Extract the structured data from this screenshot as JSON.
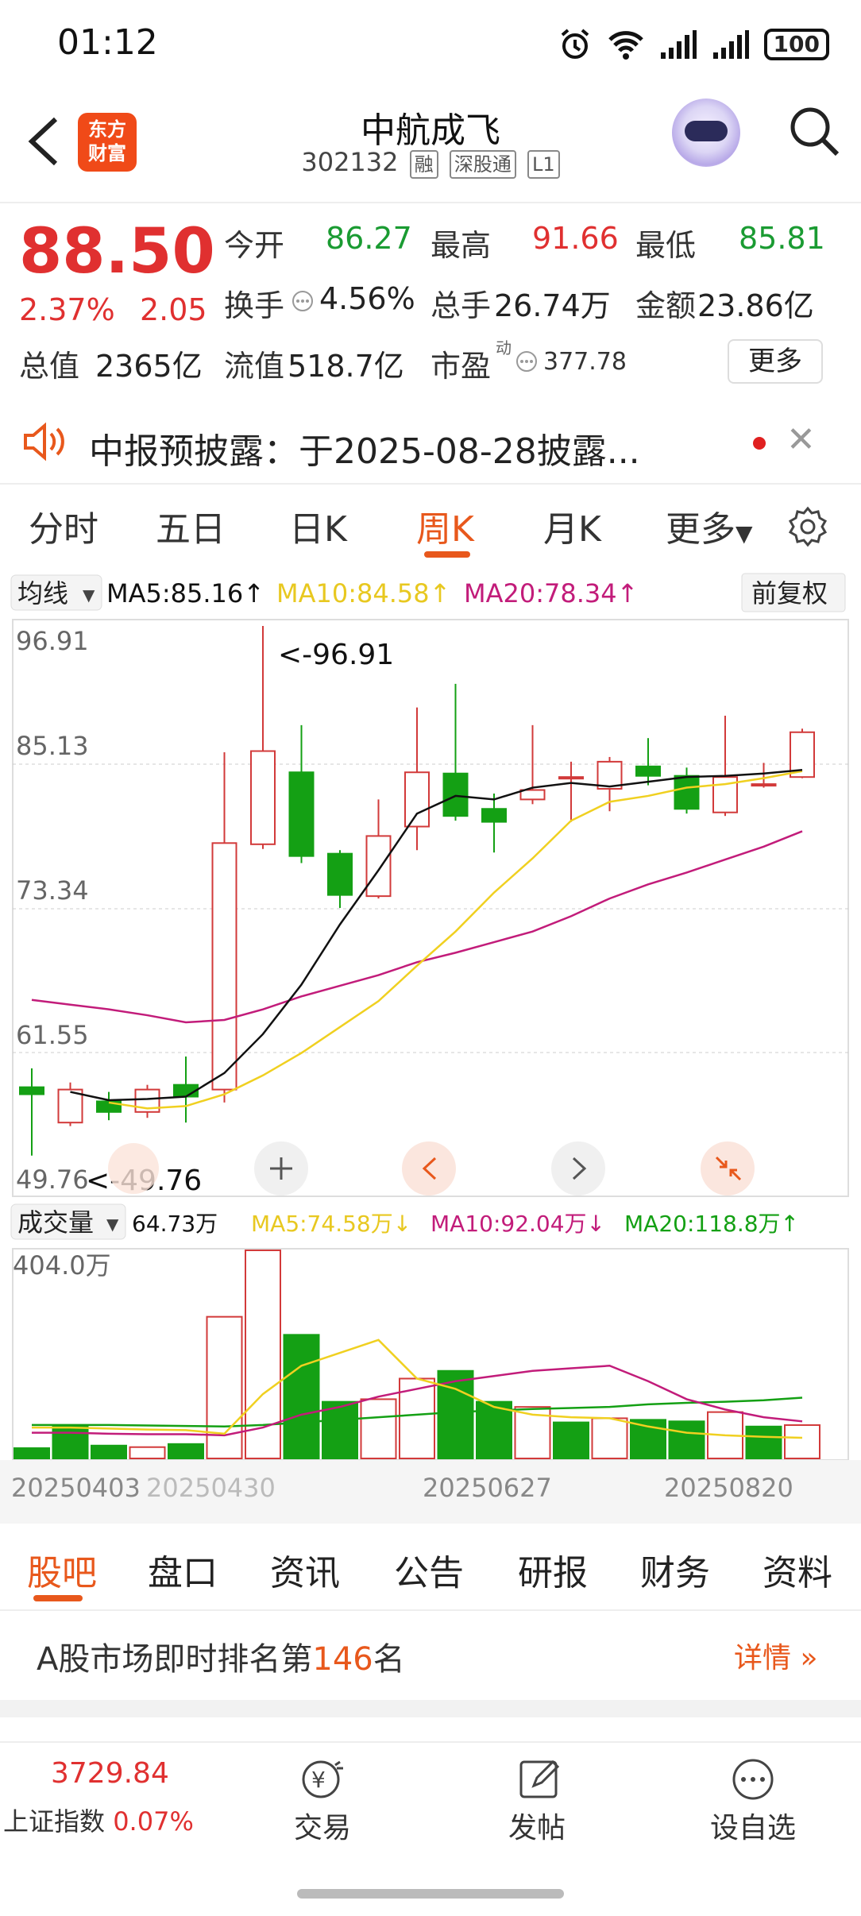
{
  "status": {
    "time": "01:12",
    "battery": "100"
  },
  "header": {
    "logo_line1": "东方",
    "logo_line2": "财富",
    "title": "中航成飞",
    "code": "302132",
    "tags": [
      "融",
      "深股通",
      "L1"
    ]
  },
  "quote": {
    "price": "88.50",
    "change_pct": "2.37%",
    "change": "2.05",
    "open_label": "今开",
    "open": "86.27",
    "high_label": "最高",
    "high": "91.66",
    "low_label": "最低",
    "low": "85.81",
    "turnover_label": "换手",
    "turnover": "4.56%",
    "volume_label": "总手",
    "volume": "26.74万",
    "amount_label": "金额",
    "amount": "23.86亿",
    "mktcap_label": "总值",
    "mktcap": "2365亿",
    "float_label": "流值",
    "float": "518.7亿",
    "pe_label": "市盈",
    "pe_sup": "动",
    "pe": "377.78",
    "more": "更多"
  },
  "notice": {
    "text": "中报预披露：于2025-08-28披露..."
  },
  "period_tabs": [
    "分时",
    "五日",
    "日K",
    "周K",
    "月K",
    "更多"
  ],
  "active_period": "周K",
  "chart_labels": {
    "ma_selector": "均线",
    "ma5": "MA5:85.16↑",
    "ma10": "MA10:84.58↑",
    "ma20": "MA20:78.34↑",
    "fq": "前复权",
    "y_ticks": [
      "96.91",
      "85.13",
      "73.34",
      "61.55",
      "49.76"
    ],
    "max_annot": "<-96.91",
    "min_annot": "<-49.76",
    "vol_selector": "成交量",
    "vol_now": "64.73万",
    "vol_ma5": "MA5:74.58万↓",
    "vol_ma10": "MA10:92.04万↓",
    "vol_ma20": "MA20:118.8万↑",
    "vol_max": "404.0万",
    "x_ticks": [
      "20250403",
      "20250430",
      "20250627",
      "20250820"
    ]
  },
  "colors": {
    "up": "#d23a3a",
    "down": "#14a014",
    "ma5": "#111111",
    "ma10": "#f0d020",
    "ma20": "#c21c7a",
    "accent": "#e8581c"
  },
  "chart_data": {
    "type": "candlestick",
    "period": "weekly",
    "ylim": [
      49.76,
      96.91
    ],
    "candles": [
      {
        "o": 57.8,
        "c": 57.2,
        "h": 59.4,
        "l": 52.0
      },
      {
        "o": 54.8,
        "c": 57.6,
        "h": 58.2,
        "l": 54.5
      },
      {
        "o": 56.6,
        "c": 55.7,
        "h": 57.4,
        "l": 55.0
      },
      {
        "o": 55.7,
        "c": 57.6,
        "h": 58.0,
        "l": 55.2
      },
      {
        "o": 58.0,
        "c": 57.0,
        "h": 60.4,
        "l": 54.8
      },
      {
        "o": 57.6,
        "c": 78.5,
        "h": 86.2,
        "l": 56.5
      },
      {
        "o": 78.4,
        "c": 86.3,
        "h": 96.91,
        "l": 78.0
      },
      {
        "o": 84.5,
        "c": 77.4,
        "h": 88.5,
        "l": 76.8
      },
      {
        "o": 77.6,
        "c": 74.1,
        "h": 77.9,
        "l": 73.0
      },
      {
        "o": 74.0,
        "c": 79.1,
        "h": 82.2,
        "l": 73.8
      },
      {
        "o": 79.9,
        "c": 84.5,
        "h": 90.0,
        "l": 77.9
      },
      {
        "o": 84.4,
        "c": 80.8,
        "h": 92.0,
        "l": 80.4
      },
      {
        "o": 81.4,
        "c": 80.3,
        "h": 82.7,
        "l": 77.7
      },
      {
        "o": 82.2,
        "c": 83.0,
        "h": 88.5,
        "l": 81.8
      },
      {
        "o": 84.0,
        "c": 84.1,
        "h": 85.4,
        "l": 80.3
      },
      {
        "o": 83.1,
        "c": 85.4,
        "h": 85.8,
        "l": 81.2
      },
      {
        "o": 85.0,
        "c": 84.2,
        "h": 87.4,
        "l": 83.4
      },
      {
        "o": 84.2,
        "c": 81.4,
        "h": 84.9,
        "l": 81.0
      },
      {
        "o": 81.1,
        "c": 84.1,
        "h": 89.3,
        "l": 80.8
      },
      {
        "o": 83.4,
        "c": 83.5,
        "h": 85.3,
        "l": 83.2
      },
      {
        "o": 84.1,
        "c": 87.9,
        "h": 88.2,
        "l": 84.0
      }
    ],
    "ma5": [
      null,
      57.4,
      56.7,
      56.8,
      57.0,
      59.0,
      62.3,
      66.5,
      71.6,
      76.2,
      81.0,
      82.5,
      82.2,
      83.2,
      83.6,
      83.3,
      83.7,
      84.1,
      84.2,
      84.4,
      84.7
    ],
    "ma10": [
      null,
      null,
      56.5,
      56.0,
      56.2,
      57.2,
      58.8,
      60.7,
      62.9,
      65.1,
      68.1,
      71.0,
      74.3,
      77.2,
      80.4,
      82.0,
      82.5,
      83.2,
      83.5,
      84.0,
      84.6
    ],
    "ma20": [
      65.2,
      64.8,
      64.4,
      63.9,
      63.3,
      63.5,
      64.4,
      65.5,
      66.4,
      67.3,
      68.4,
      69.2,
      70.1,
      71.0,
      72.3,
      73.8,
      75.0,
      76.0,
      77.1,
      78.2,
      79.5
    ],
    "volume": {
      "unit": "万",
      "ymax": 404.0,
      "values": [
        20,
        64,
        25,
        22,
        28,
        275,
        404,
        240,
        110,
        115,
        155,
        170,
        110,
        100,
        70,
        78,
        75,
        72,
        90,
        62,
        64.73
      ],
      "dir": [
        "d",
        "d",
        "d",
        "u",
        "d",
        "u",
        "u",
        "d",
        "d",
        "u",
        "u",
        "d",
        "d",
        "u",
        "d",
        "u",
        "d",
        "d",
        "u",
        "d",
        "u"
      ],
      "ma5": [
        60,
        60,
        58,
        56,
        55,
        48,
        125,
        180,
        205,
        230,
        155,
        135,
        100,
        85,
        80,
        78,
        62,
        50,
        45,
        42,
        40
      ],
      "ma10": [
        50,
        50,
        48,
        47,
        47,
        45,
        60,
        85,
        100,
        120,
        135,
        150,
        160,
        170,
        175,
        180,
        150,
        115,
        95,
        80,
        72
      ],
      "ma20": [
        65,
        65,
        65,
        64,
        63,
        62,
        65,
        70,
        75,
        80,
        85,
        90,
        93,
        96,
        98,
        100,
        105,
        108,
        110,
        113,
        118
      ]
    }
  },
  "bottom_tabs": [
    "股吧",
    "盘口",
    "资讯",
    "公告",
    "研报",
    "财务",
    "资料"
  ],
  "rank": {
    "prefix": "A股市场即时排名第",
    "num": "146",
    "suffix": "名",
    "detail": "详情"
  },
  "bottom_bar": {
    "index_value": "3729.84",
    "index_name": "上证指数",
    "index_change": "0.07%",
    "trade": "交易",
    "post": "发帖",
    "watch": "设自选"
  }
}
